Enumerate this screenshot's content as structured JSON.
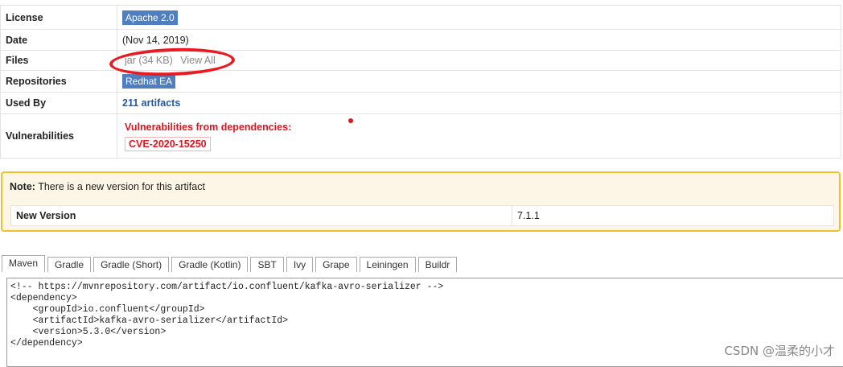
{
  "info": {
    "license": {
      "label": "License",
      "value": "Apache 2.0"
    },
    "date": {
      "label": "Date",
      "value": "(Nov 14, 2019)"
    },
    "files": {
      "label": "Files",
      "jar": "jar (34 KB)",
      "view_all": "View All"
    },
    "repositories": {
      "label": "Repositories",
      "value": "Redhat EA"
    },
    "used_by": {
      "label": "Used By",
      "value": "211 artifacts"
    },
    "vulnerabilities": {
      "label": "Vulnerabilities",
      "title": "Vulnerabilities from dependencies:",
      "cve": "CVE-2020-15250"
    }
  },
  "note": {
    "prefix": "Note:",
    "text": " There is a new version for this artifact",
    "new_version_label": "New Version",
    "new_version_value": "7.1.1"
  },
  "tabs": [
    "Maven",
    "Gradle",
    "Gradle (Short)",
    "Gradle (Kotlin)",
    "SBT",
    "Ivy",
    "Grape",
    "Leiningen",
    "Buildr"
  ],
  "active_tab": "Maven",
  "code": "<!-- https://mvnrepository.com/artifact/io.confluent/kafka-avro-serializer -->\n<dependency>\n    <groupId>io.confluent</groupId>\n    <artifactId>kafka-avro-serializer</artifactId>\n    <version>5.3.0</version>\n</dependency>",
  "watermark": "CSDN @温柔的小才",
  "colors": {
    "badge": "#4f7fbf",
    "link": "#1f5aa6",
    "danger": "#e0141e",
    "note_border": "#f0c12c",
    "annotation": "#ea1a20"
  }
}
